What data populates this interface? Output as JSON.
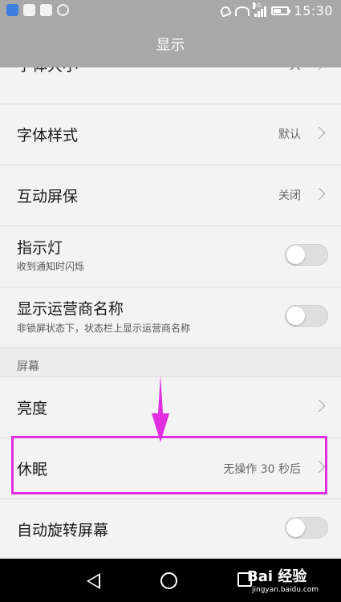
{
  "status_bar": {
    "time": "15:30",
    "network": "3G",
    "left_icons": [
      "app-icon",
      "file-icon",
      "image-icon",
      "ring-icon"
    ],
    "right_icons": [
      "mute-icon",
      "wifi-icon",
      "signal-icon",
      "battery-icon"
    ]
  },
  "header": {
    "title": "显示"
  },
  "settings": {
    "font_size": {
      "label": "字体大小",
      "value": "大"
    },
    "font_style": {
      "label": "字体样式",
      "value": "默认"
    },
    "screensaver": {
      "label": "互动屏保",
      "value": "关闭"
    },
    "indicator": {
      "label": "指示灯",
      "subtitle": "收到通知时闪烁",
      "enabled": false
    },
    "carrier_name": {
      "label": "显示运营商名称",
      "subtitle": "非锁屏状态下，状态栏上显示运营商名称",
      "enabled": false
    },
    "section_screen": "屏幕",
    "brightness": {
      "label": "亮度"
    },
    "sleep": {
      "label": "休眠",
      "value": "无操作 30 秒后"
    },
    "auto_rotate": {
      "label": "自动旋转屏幕",
      "enabled": false
    }
  },
  "annotation": {
    "highlight_color": "#e02ee0"
  },
  "navigation": {
    "buttons": [
      "back-icon",
      "home-icon",
      "recent-apps-icon"
    ]
  },
  "watermark": {
    "brand": "Bai 经验",
    "url": "jingyan.baidu.com"
  }
}
